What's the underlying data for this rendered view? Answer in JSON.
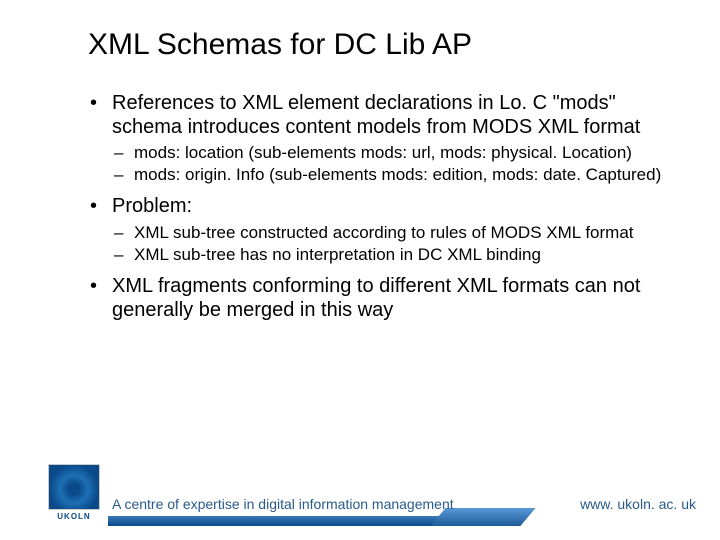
{
  "title": "XML Schemas for DC Lib AP",
  "bullets": [
    {
      "text": "References to XML element declarations in Lo. C \"mods\" schema introduces content models from MODS XML format",
      "children": [
        "mods: location (sub-elements mods: url, mods: physical. Location)",
        "mods: origin. Info (sub-elements mods: edition, mods: date. Captured)"
      ]
    },
    {
      "text": "Problem:",
      "children": [
        "XML sub-tree constructed according to rules of MODS XML format",
        "XML sub-tree has no interpretation in DC XML binding"
      ]
    },
    {
      "text": "XML fragments conforming to different XML formats can not generally be merged in this way",
      "children": []
    }
  ],
  "footer": {
    "logo_text": "UKOLN",
    "tagline": "A centre of expertise in digital information management",
    "url": "www. ukoln. ac. uk"
  }
}
